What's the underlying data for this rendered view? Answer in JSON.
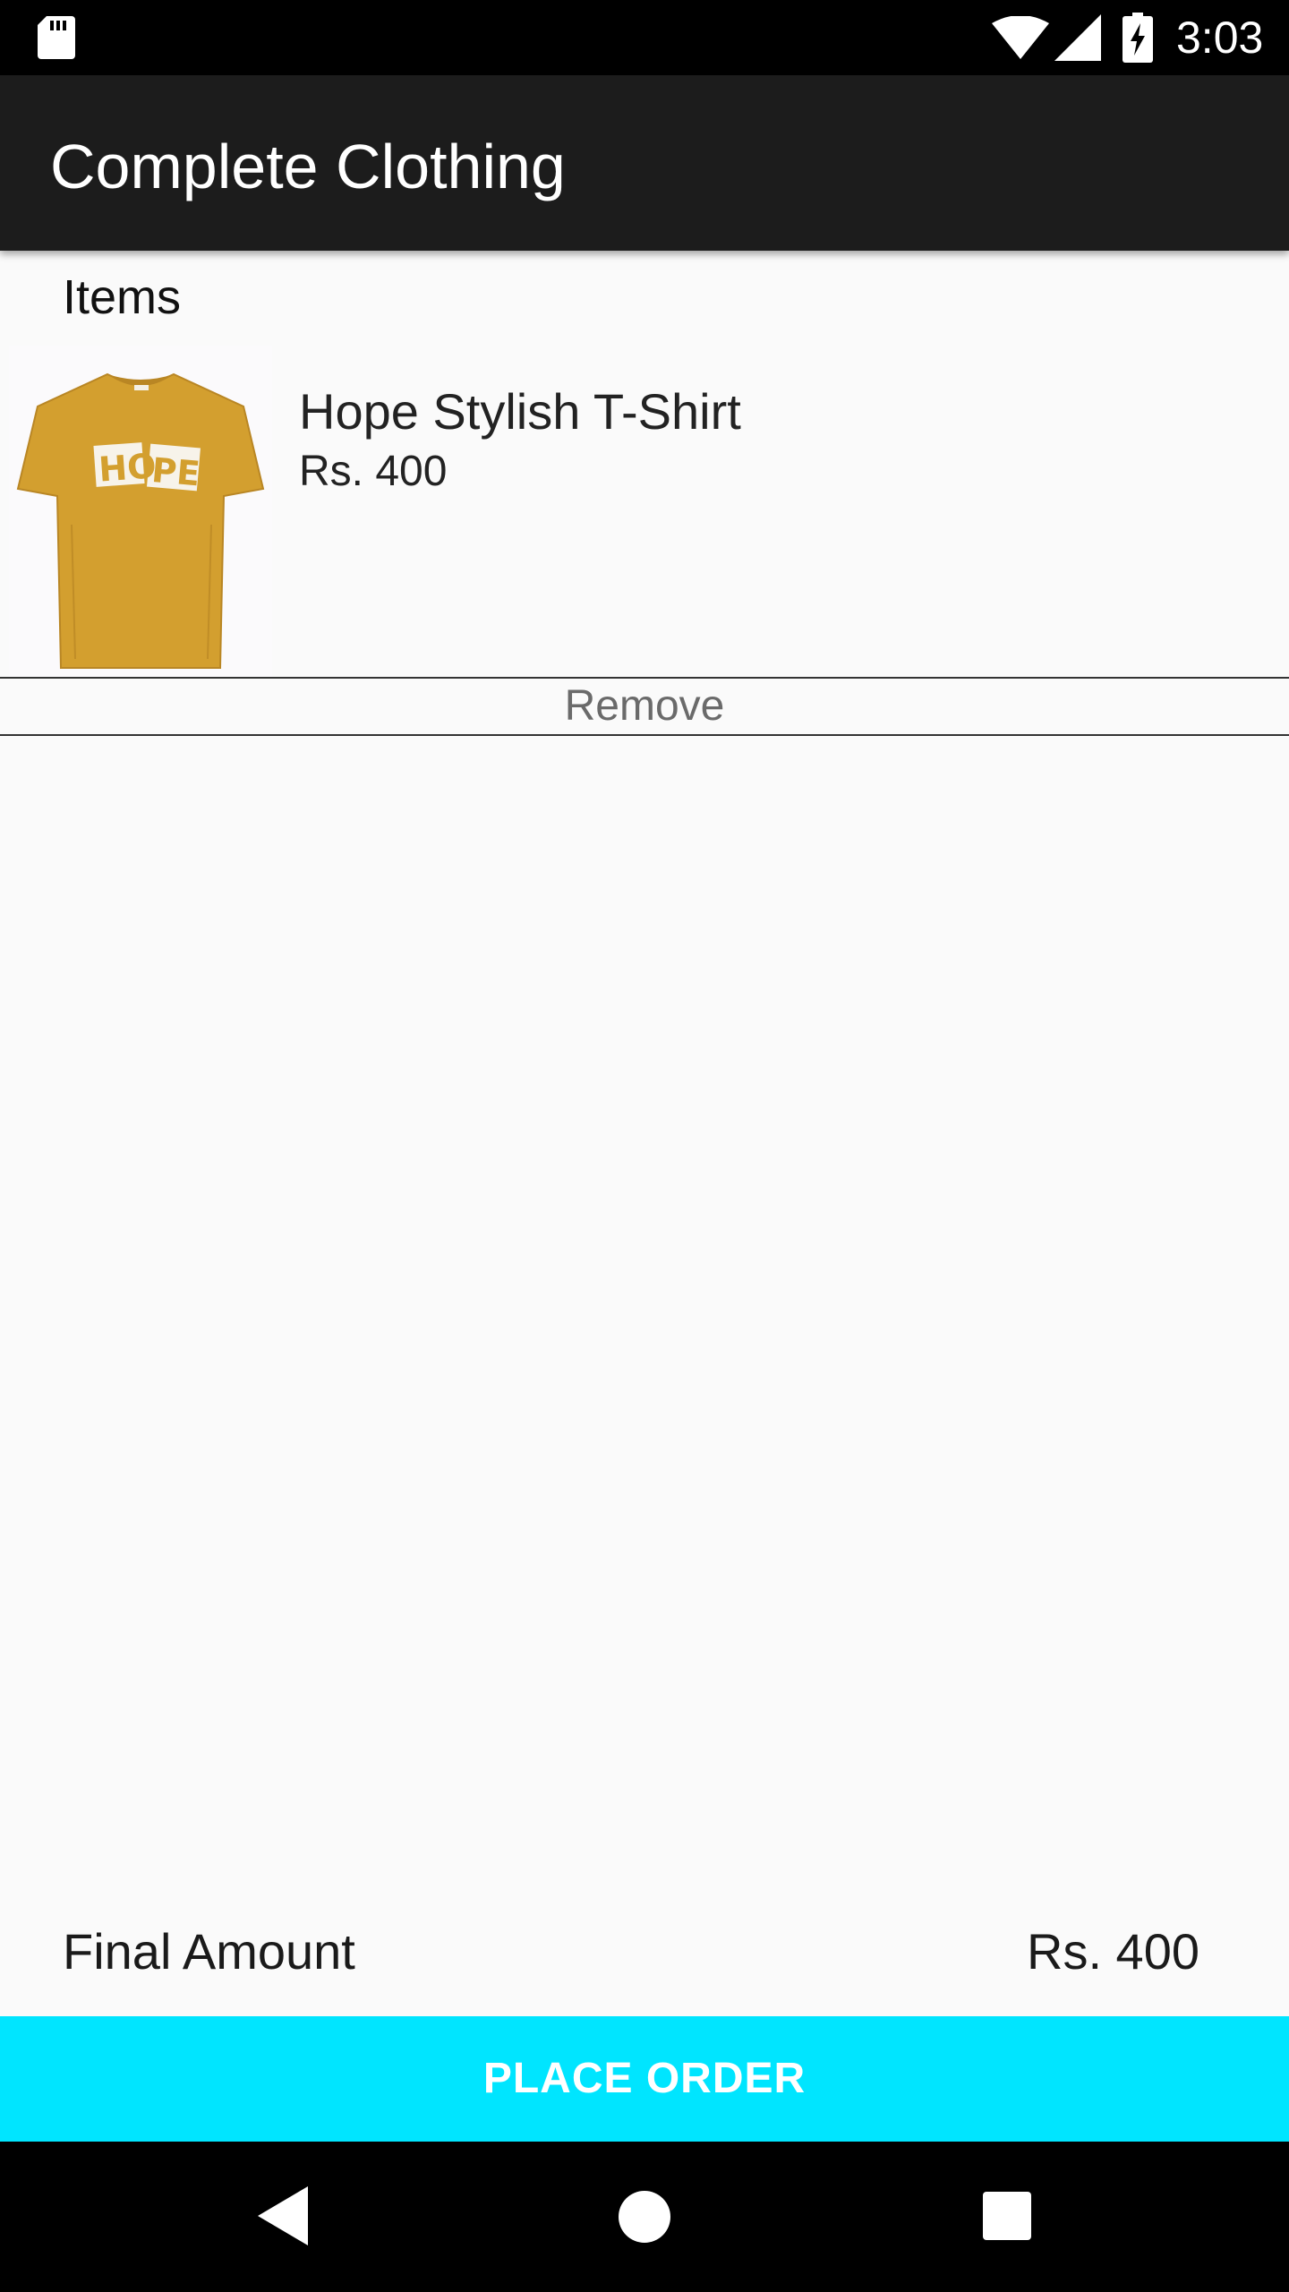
{
  "status_bar": {
    "time": "3:03",
    "icons": [
      "sd-card-icon",
      "wifi-icon",
      "cell-signal-icon",
      "battery-charging-icon"
    ]
  },
  "toolbar": {
    "title": "Complete Clothing"
  },
  "cart": {
    "section_label": "Items",
    "items": [
      {
        "name": "Hope Stylish T-Shirt",
        "price": "Rs. 400",
        "image": "mustard-t-shirt-hope-print",
        "remove_label": "Remove"
      }
    ]
  },
  "summary": {
    "total_label": "Final Amount",
    "total_value": "Rs. 400"
  },
  "actions": {
    "place_order_label": "PLACE ORDER"
  },
  "colors": {
    "toolbar": "#1c1c1c",
    "accent": "#00e5ff",
    "background": "#fafafa",
    "shirt": "#d39f2f"
  },
  "navigation": {
    "icons": [
      "back-icon",
      "home-icon",
      "recents-icon"
    ]
  }
}
